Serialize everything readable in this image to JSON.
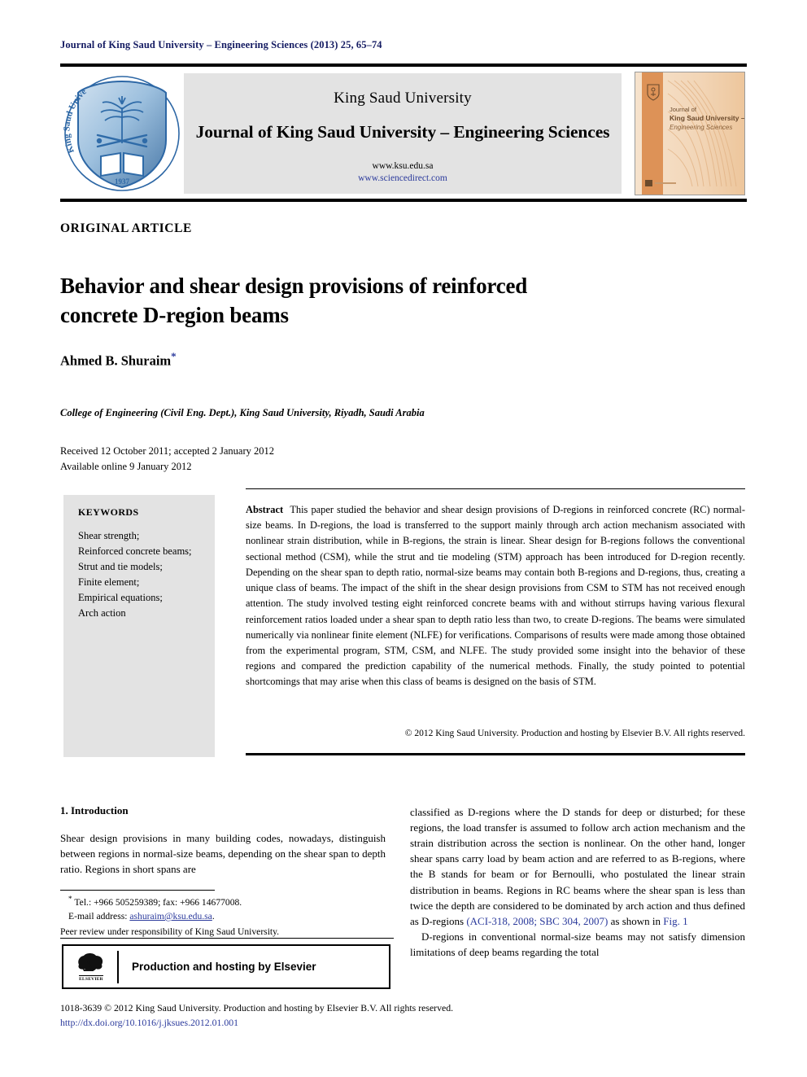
{
  "running_head": "Journal of King Saud University – Engineering Sciences (2013) 25, 65–74",
  "masthead": {
    "university": "King Saud University",
    "journal_title": "Journal of King Saud University – Engineering Sciences",
    "url_university": "www.ksu.edu.sa",
    "url_sciencedirect": "www.sciencedirect.com",
    "logo_alt": "King Saud University shield logo",
    "logo_year": "1937",
    "logo_text_left": "King Saud University",
    "cover_line1": "Journal of",
    "cover_line2": "King Saud University –",
    "cover_line3": "Engineering Sciences"
  },
  "article": {
    "type_label": "ORIGINAL ARTICLE",
    "title": "Behavior and shear design provisions of reinforced concrete D-region beams",
    "author": "Ahmed B. Shuraim",
    "author_note_marker": "*",
    "affiliation": "College of Engineering (Civil Eng. Dept.), King Saud University, Riyadh, Saudi Arabia",
    "received": "Received 12 October 2011; accepted 2 January 2012",
    "available": "Available online 9 January 2012"
  },
  "keywords": {
    "heading": "KEYWORDS",
    "items": [
      "Shear strength;",
      "Reinforced concrete beams;",
      "Strut and tie models;",
      "Finite element;",
      "Empirical equations;",
      "Arch action"
    ]
  },
  "abstract": {
    "label": "Abstract",
    "body": "This paper studied the behavior and shear design provisions of D-regions in reinforced concrete (RC) normal-size beams. In D-regions, the load is transferred to the support mainly through arch action mechanism associated with nonlinear strain distribution, while in B-regions, the strain is linear. Shear design for B-regions follows the conventional sectional method (CSM), while the strut and tie modeling (STM) approach has been introduced for D-region recently. Depending on the shear span to depth ratio, normal-size beams may contain both B-regions and D-regions, thus, creating a unique class of beams. The impact of the shift in the shear design provisions from CSM to STM has not received enough attention. The study involved testing eight reinforced concrete beams with and without stirrups having various flexural reinforcement ratios loaded under a shear span to depth ratio less than two, to create D-regions. The beams were simulated numerically via nonlinear finite element (NLFE) for verifications. Comparisons of results were made among those obtained from the experimental program, STM, CSM, and NLFE. The study provided some insight into the behavior of these regions and compared the prediction capability of the numerical methods. Finally, the study pointed to potential shortcomings that may arise when this class of beams is designed on the basis of STM.",
    "copyright": "© 2012 King Saud University. Production and hosting by Elsevier B.V. All rights reserved."
  },
  "introduction": {
    "heading": "1. Introduction",
    "para1_left": "Shear design provisions in many building codes, nowadays, distinguish between regions in normal-size beams, depending on the shear span to depth ratio. Regions in short spans are",
    "para1_right_a": "classified as D-regions where the D stands for deep or disturbed; for these regions, the load transfer is assumed to follow arch action mechanism and the strain distribution across the section is nonlinear. On the other hand, longer shear spans carry load by beam action and are referred to as B-regions, where the B stands for beam or for Bernoulli, who postulated the linear strain distribution in beams. Regions in RC beams where the shear span is less than twice the depth are considered to be dominated by arch action and thus defined as D-regions ",
    "citation_1": "(ACI-318, 2008; SBC 304, 2007)",
    "para1_right_b": " as shown in ",
    "citation_2": "Fig. 1",
    "para2_right": "D-regions in conventional normal-size beams may not satisfy dimension limitations of deep beams regarding the total"
  },
  "footnotes": {
    "tel": "Tel.: +966 505259389; fax: +966 14677008.",
    "email_label": "E-mail address:",
    "email": "ashuraim@ksu.edu.sa",
    "peer_review": "Peer review under responsibility of King Saud University."
  },
  "elsevier": {
    "wordmark": "ELSEVIER",
    "label": "Production and hosting by Elsevier"
  },
  "footer": {
    "issn_line": "1018-3639 © 2012 King Saud University. Production and hosting by Elsevier B.V. All rights reserved.",
    "doi": "http://dx.doi.org/10.1016/j.jksues.2012.01.001"
  },
  "colors": {
    "link": "#2b3a9c",
    "running_head": "#151c63",
    "panel_gray": "#e3e3e3",
    "cover_orange": "#e08e4a"
  }
}
